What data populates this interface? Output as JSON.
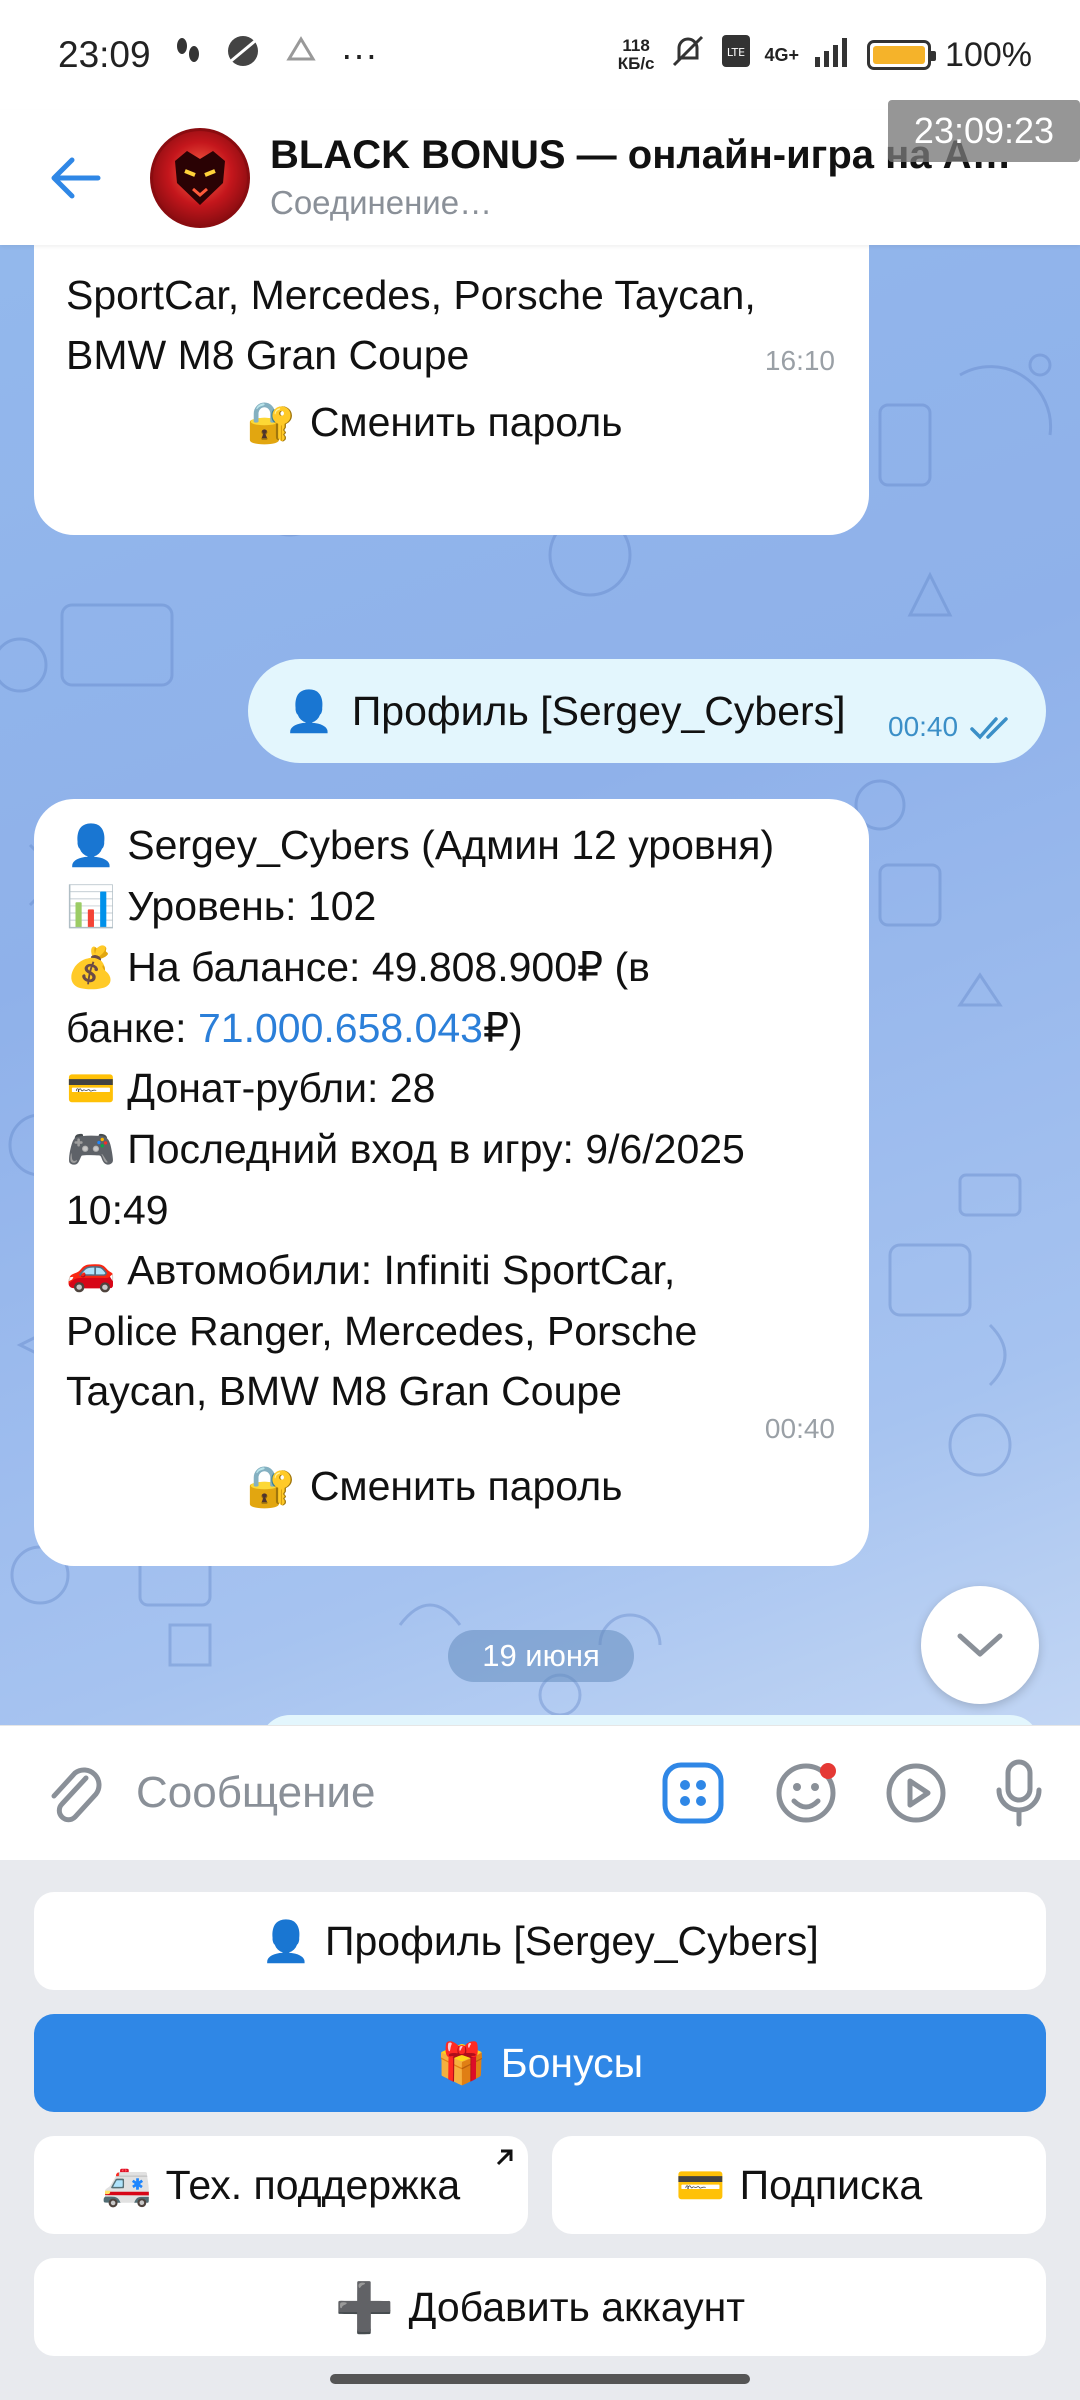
{
  "status_bar": {
    "time": "23:09",
    "speed_value": "118",
    "speed_unit": "КБ/с",
    "network": "4G+",
    "battery": "100%",
    "clock_overlay": "23:09:23"
  },
  "header": {
    "title": "BLACK BONUS — онлайн-игра на Andro",
    "subtitle": "Соединение…"
  },
  "messages": {
    "first_partial": {
      "line1": "SportCar, Mercedes, Porsche Taycan,",
      "line2": "BMW M8 Gran Coupe",
      "time": "16:10",
      "button_label": "Сменить пароль"
    },
    "outgoing": {
      "text": "Профиль [Sergey_Cybers]",
      "time": "00:40"
    },
    "profile": {
      "name_line": "Sergey_Cybers (Админ 12 уровня)",
      "level_line": "Уровень: 102",
      "balance_line": "На балансе: 49.808.900₽ (в",
      "bank_prefix": "банке: ",
      "bank_value": "71.000.658.043",
      "bank_suffix": "₽)",
      "donate_line": "Донат-рубли: 28",
      "last_login_line1": "Последний вход в игру: 9/6/2025",
      "last_login_line2": "10:49",
      "cars_line1": "Автомобили: Infiniti SportCar,",
      "cars_line2": "Police Ranger, Mercedes, Porsche",
      "cars_line3": "Taycan, BMW M8 Gran Coupe",
      "time": "00:40",
      "button_label": "Сменить пароль"
    },
    "date_separator": "19 июня"
  },
  "input": {
    "placeholder": "Сообщение"
  },
  "keyboard": {
    "profile": "Профиль [Sergey_Cybers]",
    "bonuses": "Бонусы",
    "support": "Тех. поддержка",
    "subscription": "Подписка",
    "add_account": "Добавить аккаунт"
  },
  "colors": {
    "accent": "#2f87e6",
    "link": "#2b7fd9",
    "outgoing_bubble": "#e3f6fd",
    "chat_bg": "#93b8ec"
  }
}
